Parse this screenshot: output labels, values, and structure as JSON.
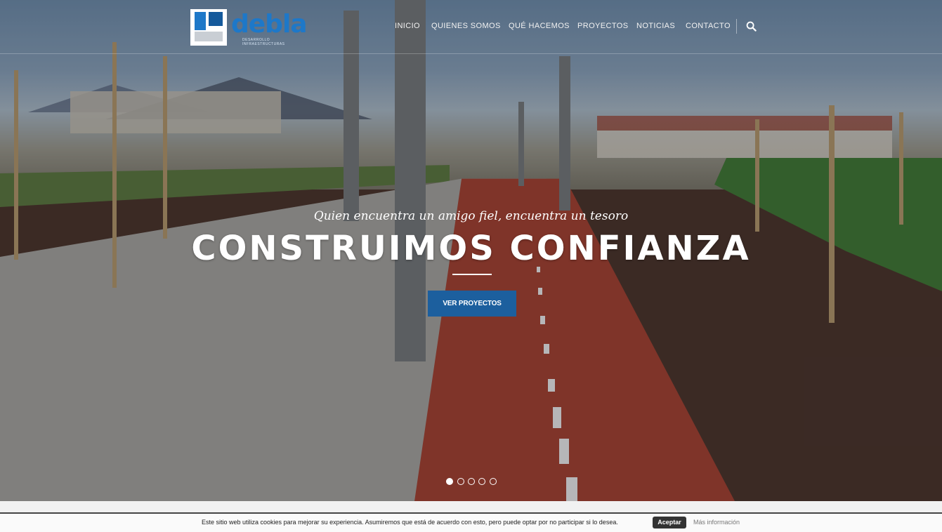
{
  "brand": {
    "name": "debla",
    "tagline": "DESARROLLO INFRAESTRUCTURAS",
    "accent": "#1e78c8"
  },
  "nav": {
    "items": [
      {
        "label": "INICIO"
      },
      {
        "label": "QUIENES SOMOS"
      },
      {
        "label": "QUÉ HACEMOS"
      },
      {
        "label": "PROYECTOS"
      },
      {
        "label": "NOTICIAS"
      },
      {
        "label": "CONTACTO"
      }
    ],
    "search_icon": "search-icon"
  },
  "hero": {
    "subtitle": "Quien encuentra un amigo fiel, encuentra un tesoro",
    "title": "CONSTRUIMOS CONFIANZA",
    "cta_label": "VER PROYECTOS",
    "cta_color": "#1c5f9e",
    "slides_total": 5,
    "slide_active": 1
  },
  "cookie": {
    "text": "Este sitio web utiliza cookies para mejorar su experiencia. Asumiremos que está de acuerdo con esto, pero puede optar por no participar si lo desea.",
    "accept_label": "Aceptar",
    "more_label": "Más información"
  }
}
